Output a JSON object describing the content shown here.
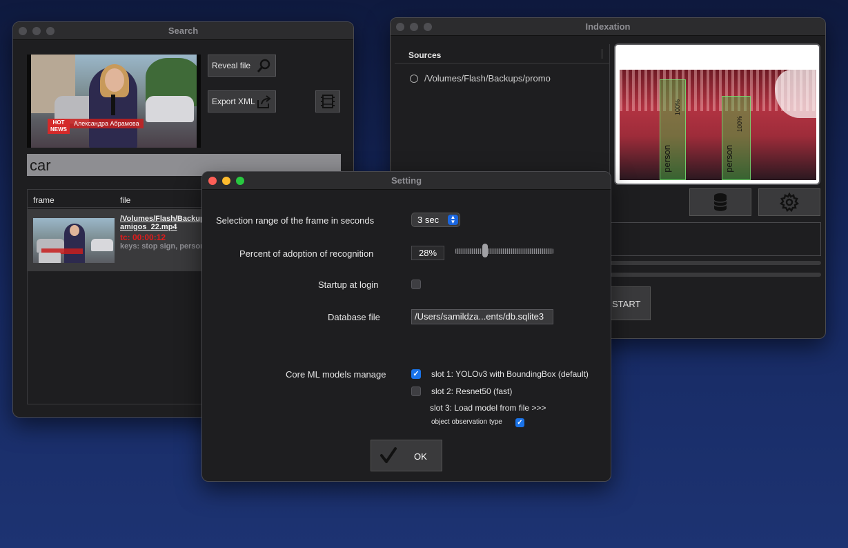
{
  "search_window": {
    "title": "Search",
    "preview": {
      "badge_hot": "HOT",
      "badge_news": "NEWS",
      "presenter": "Александра Абрамова"
    },
    "reveal_label": "Reveal file",
    "export_label": "Export XML",
    "query": "car",
    "columns": [
      "frame",
      "file"
    ],
    "result": {
      "path_line1": "/Volumes/Flash/Backup",
      "path_line2": "amigos_22.mp4",
      "timecode": "tc: 00:00:12",
      "keys": "keys: stop sign, person"
    }
  },
  "index_window": {
    "title": "Indexation",
    "sources_header": "Sources",
    "sources": [
      "/Volumes/Flash/Backups/promo"
    ],
    "detections": [
      {
        "label": "person",
        "confidence": "100%"
      },
      {
        "label": "person",
        "confidence": "100%"
      }
    ],
    "start_label": "START"
  },
  "setting_window": {
    "title": "Setting",
    "selection_range_label": "Selection range of the frame in seconds",
    "selection_range_value": "3 sec",
    "adoption_label": "Percent of adoption of recognition",
    "adoption_value": "28%",
    "adoption_fraction": 0.28,
    "startup_label": "Startup at login",
    "startup_checked": false,
    "database_label": "Database file",
    "database_value": "/Users/samildza...ents/db.sqlite3",
    "models_label": "Core ML models manage",
    "slots": [
      {
        "label": "slot 1:  YOLOv3 with BoundingBox (default)",
        "checked": true
      },
      {
        "label": "slot 2:  Resnet50 (fast)",
        "checked": false
      }
    ],
    "slot3_label": "slot 3: Load model from file  >>>",
    "observation_label": "object observation type",
    "observation_checked": true,
    "ok_label": "OK"
  },
  "colors": {
    "accent": "#1a73e8",
    "timecode": "#e21b1b",
    "traffic_red": "#fe5f57",
    "traffic_yellow": "#febc2e",
    "traffic_green": "#28c840"
  }
}
